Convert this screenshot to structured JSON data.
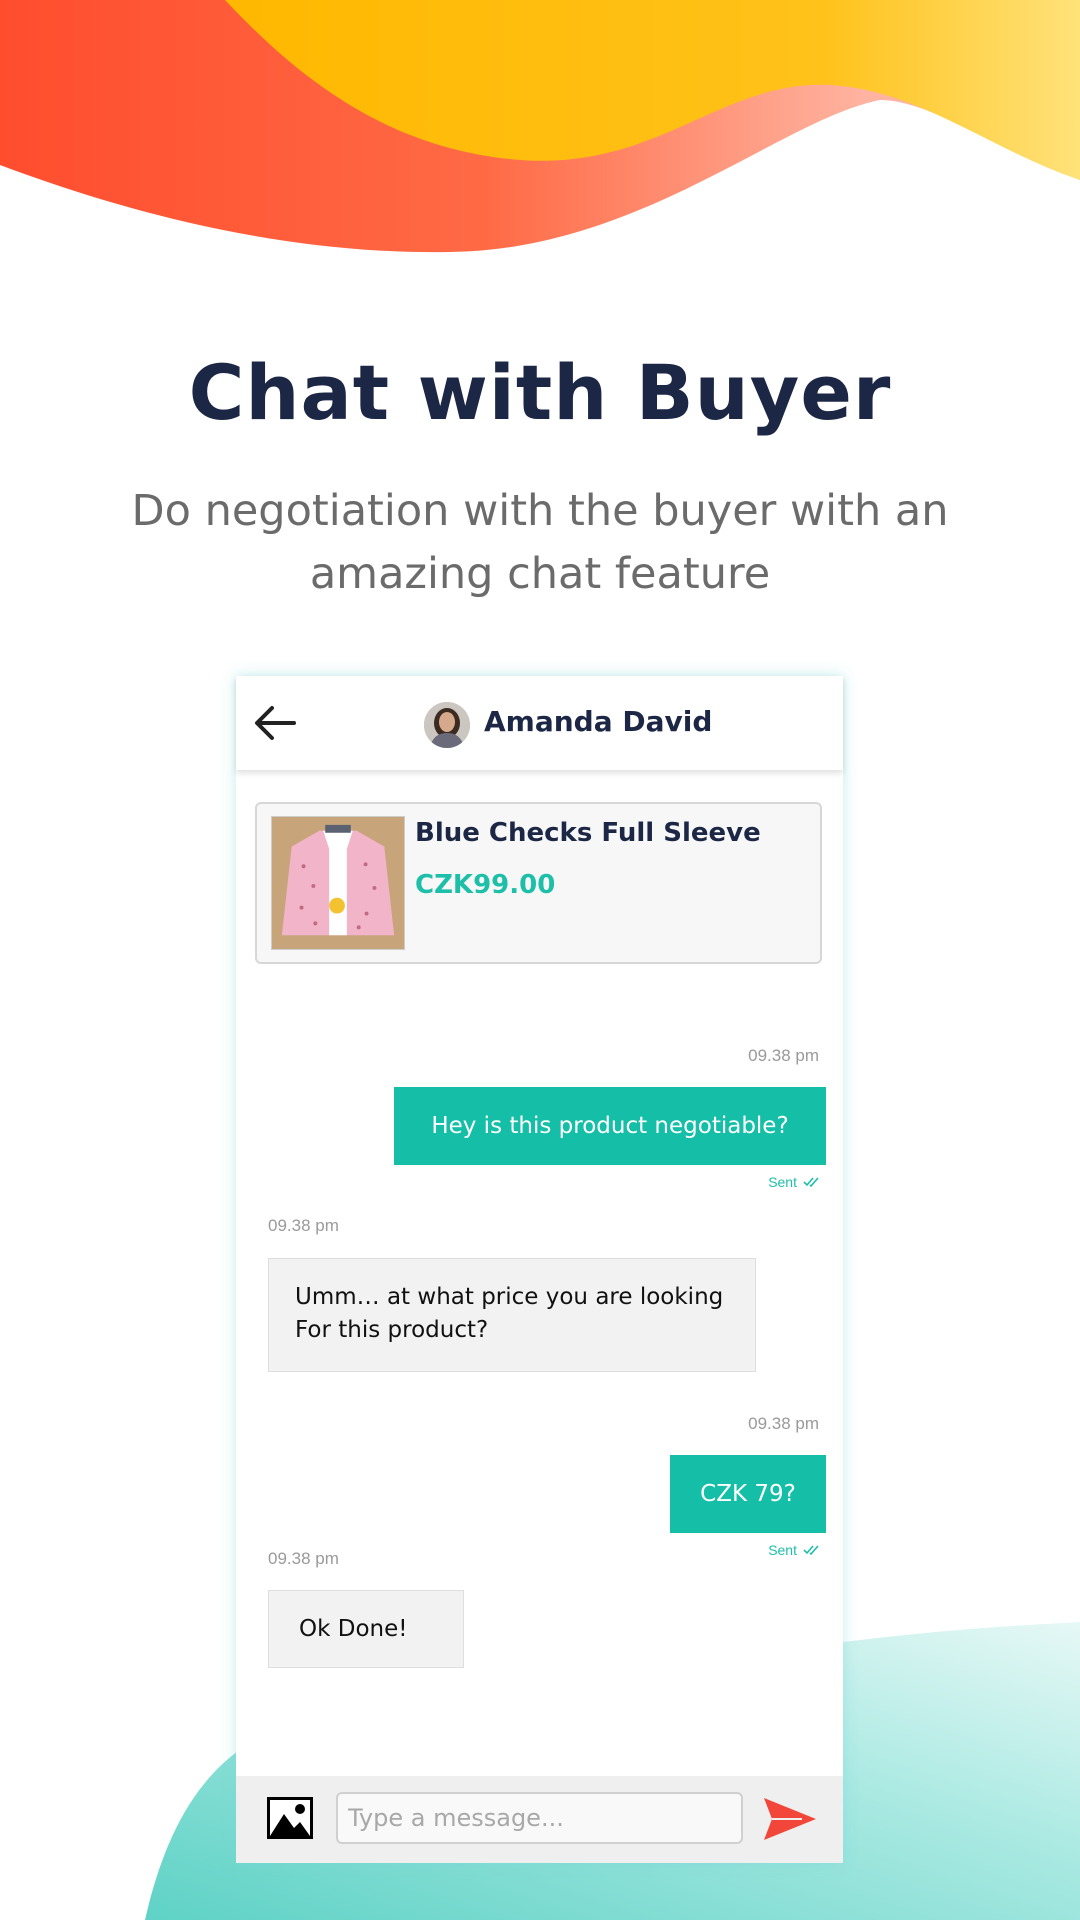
{
  "header": {
    "title": "Chat with Buyer",
    "subtitle": "Do negotiation with the buyer with an amazing chat feature"
  },
  "colors": {
    "accent": "#15bfa7",
    "title": "#1c2745",
    "wave_orange": "#ff5a33",
    "wave_yellow": "#ffbd00",
    "wave_teal": "#6fd6cc"
  },
  "chat": {
    "contact_name": "Amanda David",
    "product": {
      "title": "Blue Checks Full Sleeve",
      "price": "CZK99.00"
    },
    "messages": [
      {
        "direction": "out",
        "time": "09.38 pm",
        "text": "Hey is this product negotiable?",
        "status": "Sent"
      },
      {
        "direction": "in",
        "time": "09.38 pm",
        "text": "Umm… at what price you are looking For this product?"
      },
      {
        "direction": "out",
        "time": "09.38 pm",
        "text": "CZK 79?",
        "status": "Sent"
      },
      {
        "direction": "in",
        "time": "09.38 pm",
        "text": "Ok Done!"
      }
    ],
    "composer": {
      "placeholder": "Type a message..."
    }
  },
  "icons": {
    "back": "arrow-left-icon",
    "attach": "image-icon",
    "send": "send-icon",
    "read": "double-check-icon"
  }
}
